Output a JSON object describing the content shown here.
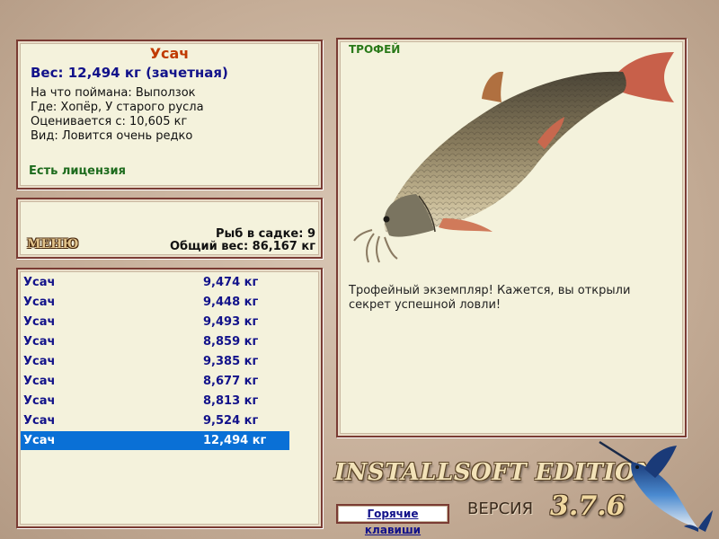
{
  "info": {
    "fish_name": "Усач",
    "weight_line": "Вес: 12,494 кг (зачетная)",
    "caught_with": "На что поймана: Выползок",
    "location": "Где: Хопёр, У старого русла",
    "valued_from": "Оценивается с: 10,605 кг",
    "species_note": "Вид: Ловится очень редко",
    "license": "Есть лицензия"
  },
  "keepnet": {
    "menu_label": "МЕНЮ",
    "fish_count": "Рыб в садке: 9",
    "total_weight": "Общий вес: 86,167 кг"
  },
  "catch_list": [
    {
      "name": "Усач",
      "weight": "9,474 кг"
    },
    {
      "name": "Усач",
      "weight": "9,448 кг"
    },
    {
      "name": "Усач",
      "weight": "9,493 кг"
    },
    {
      "name": "Усач",
      "weight": "8,859 кг"
    },
    {
      "name": "Усач",
      "weight": "9,385 кг"
    },
    {
      "name": "Усач",
      "weight": "8,677 кг"
    },
    {
      "name": "Усач",
      "weight": "8,813 кг"
    },
    {
      "name": "Усач",
      "weight": "9,524 кг"
    },
    {
      "name": "Усач",
      "weight": "12,494 кг",
      "selected": true
    }
  ],
  "trophy": {
    "tag": "ТРОФЕЙ",
    "description": "Трофейный экземпляр! Кажется, вы открыли секрет успешной ловли!"
  },
  "branding": {
    "edition": "INSTALLSOFT EDITION",
    "version_label": "ВЕРСИЯ",
    "version_number": "3.7.6"
  },
  "hotkeys_label": "Горячие клавиши",
  "colors": {
    "panel_bg": "#f4f2dc",
    "panel_border": "#7a3b33",
    "selection": "#0a70d6",
    "fish_name": "#c03a00",
    "list_text": "#12128a",
    "license": "#1d6b1d"
  }
}
